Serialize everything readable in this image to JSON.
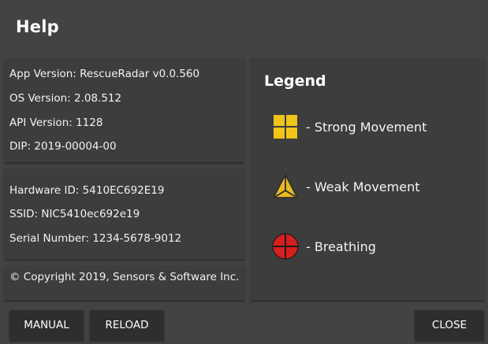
{
  "dialog": {
    "title": "Help"
  },
  "info": {
    "app_version": "App Version: RescueRadar v0.0.560",
    "os_version": "OS Version: 2.08.512",
    "api_version": "API Version: 1128",
    "dip": "DIP: 2019-00004-00"
  },
  "hardware": {
    "hardware_id": "Hardware ID: 5410EC692E19",
    "ssid": "SSID: NIC5410ec692e19",
    "serial_number": "Serial Number: 1234-5678-9012"
  },
  "copyright": "© Copyright 2019, Sensors & Software Inc.",
  "legend": {
    "title": "Legend",
    "items": [
      {
        "icon": "strong-movement-icon",
        "label": "- Strong Movement"
      },
      {
        "icon": "weak-movement-icon",
        "label": "- Weak Movement"
      },
      {
        "icon": "breathing-icon",
        "label": "- Breathing"
      }
    ]
  },
  "colors": {
    "strong": "#f0c419",
    "weak": "#e8b923",
    "breathing": "#d61f1f"
  },
  "buttons": {
    "manual": "MANUAL",
    "reload": "RELOAD",
    "close": "CLOSE"
  }
}
